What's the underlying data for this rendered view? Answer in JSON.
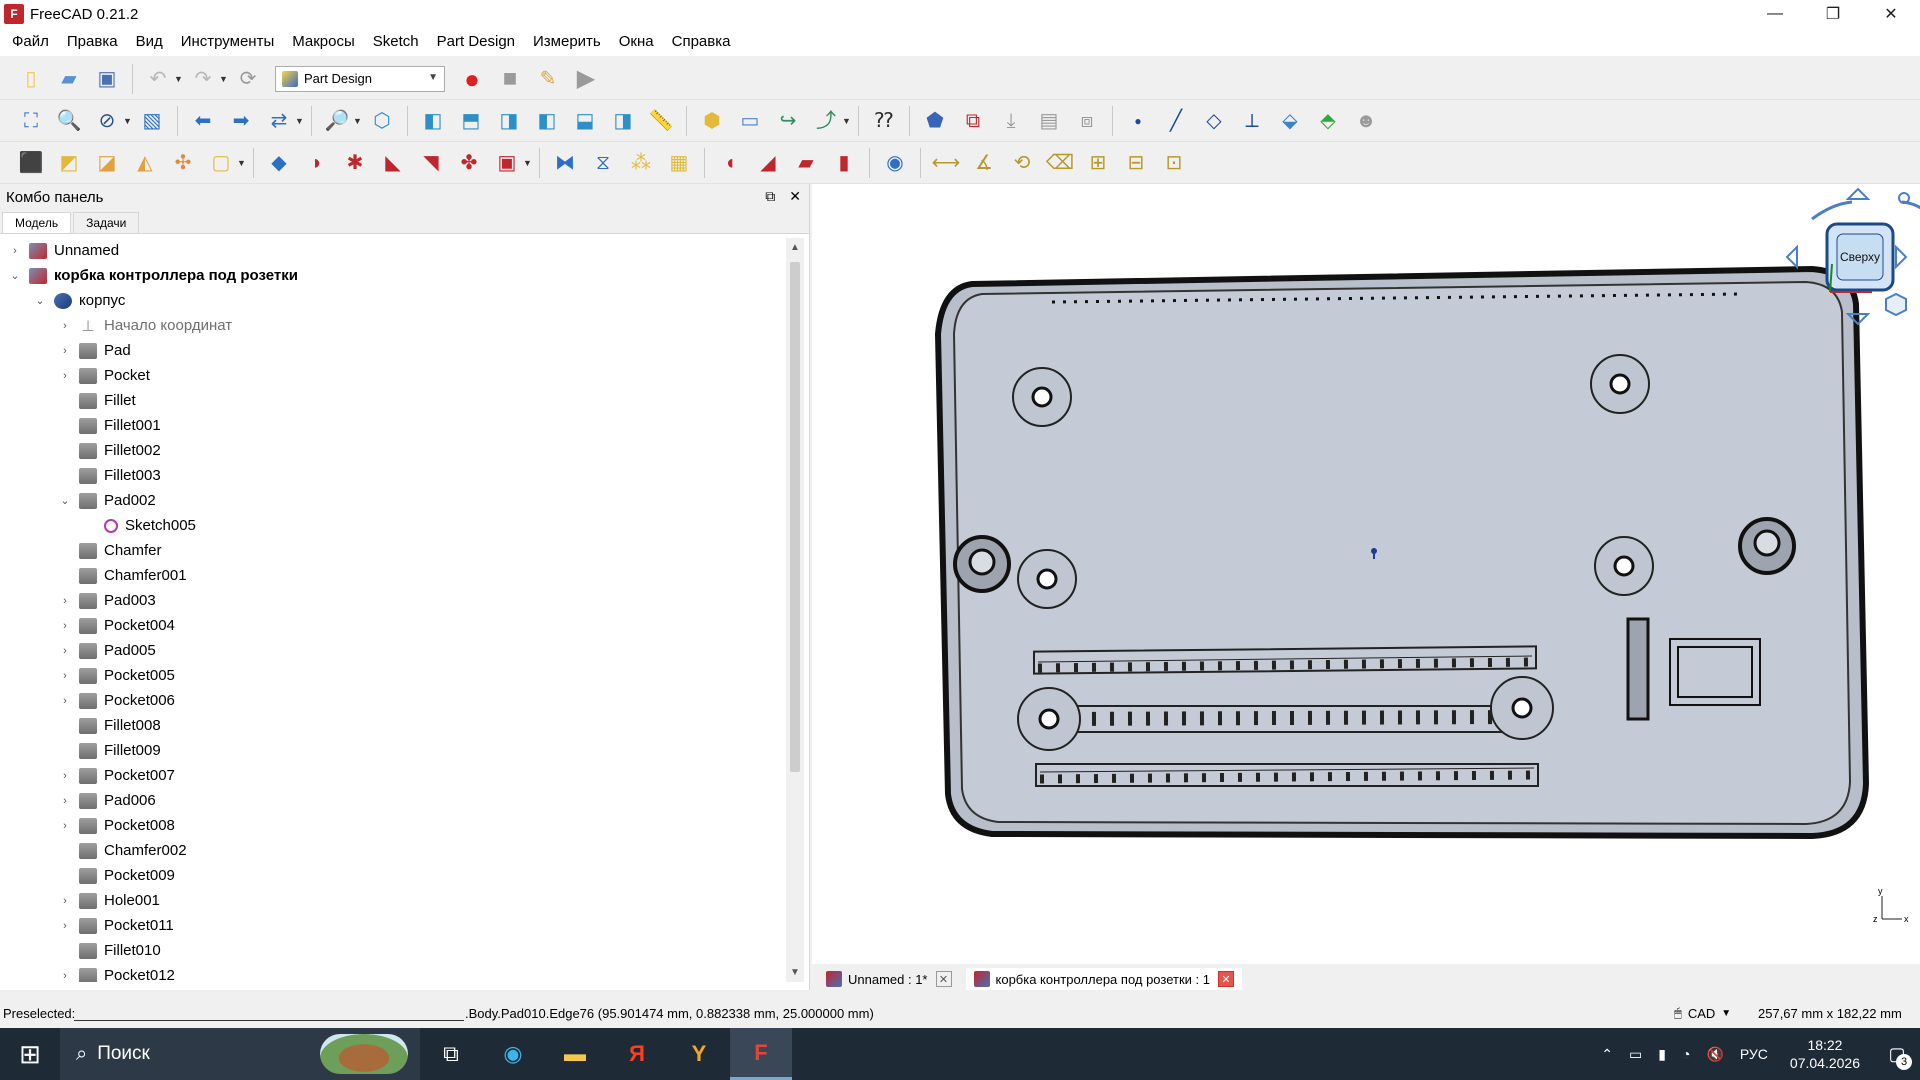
{
  "window": {
    "title": "FreeCAD 0.21.2",
    "min": "—",
    "max": "❐",
    "close": "✕"
  },
  "menu": [
    "Файл",
    "Правка",
    "Вид",
    "Инструменты",
    "Макросы",
    "Sketch",
    "Part Design",
    "Измерить",
    "Окна",
    "Справка"
  ],
  "workbench": {
    "selected": "Part Design"
  },
  "combo": {
    "title": "Комбо панель",
    "tabs": [
      "Модель",
      "Задачи"
    ],
    "tree": [
      {
        "label": "Unnamed",
        "arrow": "›",
        "icon": "doc"
      },
      {
        "label": "корбка контроллера под розетки",
        "arrow": "⌄",
        "icon": "doc",
        "bold": true
      },
      {
        "label": "корпус",
        "arrow": "⌄",
        "icon": "body"
      },
      {
        "label": "Начало координат",
        "arrow": "›",
        "icon": "origin",
        "gray": true
      },
      {
        "label": "Pad",
        "arrow": "›",
        "icon": "feat"
      },
      {
        "label": "Pocket",
        "arrow": "›",
        "icon": "feat"
      },
      {
        "label": "Fillet",
        "arrow": "",
        "icon": "feat"
      },
      {
        "label": "Fillet001",
        "arrow": "",
        "icon": "feat"
      },
      {
        "label": "Fillet002",
        "arrow": "",
        "icon": "feat"
      },
      {
        "label": "Fillet003",
        "arrow": "",
        "icon": "feat"
      },
      {
        "label": "Pad002",
        "arrow": "⌄",
        "icon": "feat"
      },
      {
        "label": "Sketch005",
        "arrow": "",
        "icon": "sketch"
      },
      {
        "label": "Chamfer",
        "arrow": "",
        "icon": "feat"
      },
      {
        "label": "Chamfer001",
        "arrow": "",
        "icon": "feat"
      },
      {
        "label": "Pad003",
        "arrow": "›",
        "icon": "feat"
      },
      {
        "label": "Pocket004",
        "arrow": "›",
        "icon": "feat"
      },
      {
        "label": "Pad005",
        "arrow": "›",
        "icon": "feat"
      },
      {
        "label": "Pocket005",
        "arrow": "›",
        "icon": "feat"
      },
      {
        "label": "Pocket006",
        "arrow": "›",
        "icon": "feat"
      },
      {
        "label": "Fillet008",
        "arrow": "",
        "icon": "feat"
      },
      {
        "label": "Fillet009",
        "arrow": "",
        "icon": "feat"
      },
      {
        "label": "Pocket007",
        "arrow": "›",
        "icon": "feat"
      },
      {
        "label": "Pad006",
        "arrow": "›",
        "icon": "feat"
      },
      {
        "label": "Pocket008",
        "arrow": "›",
        "icon": "feat"
      },
      {
        "label": "Chamfer002",
        "arrow": "",
        "icon": "feat"
      },
      {
        "label": "Pocket009",
        "arrow": "",
        "icon": "feat"
      },
      {
        "label": "Hole001",
        "arrow": "›",
        "icon": "feat"
      },
      {
        "label": "Pocket011",
        "arrow": "›",
        "icon": "feat"
      },
      {
        "label": "Fillet010",
        "arrow": "",
        "icon": "feat"
      },
      {
        "label": "Pocket012",
        "arrow": "›",
        "icon": "feat"
      }
    ]
  },
  "navcube": {
    "face": "Сверху"
  },
  "doc_tabs": [
    {
      "label": "Unnamed : 1*"
    },
    {
      "label": "корбка контроллера под розетки : 1"
    }
  ],
  "status": {
    "preselected_label": "Preselected:",
    "selection": ".Body.Pad010.Edge76 (95.901474 mm, 0.882338 mm, 25.000000 mm)",
    "nav_style": "CAD",
    "dimensions": "257,67 mm x 182,22 mm"
  },
  "taskbar": {
    "search_label": "Поиск",
    "lang": "РУС",
    "time": "18:22",
    "date": "07.04.2026",
    "notifications": "3"
  },
  "colors": {
    "model_fill": "#c5cbd6",
    "model_edge": "#1a1a1a",
    "taskbar": "#1f2a37"
  }
}
